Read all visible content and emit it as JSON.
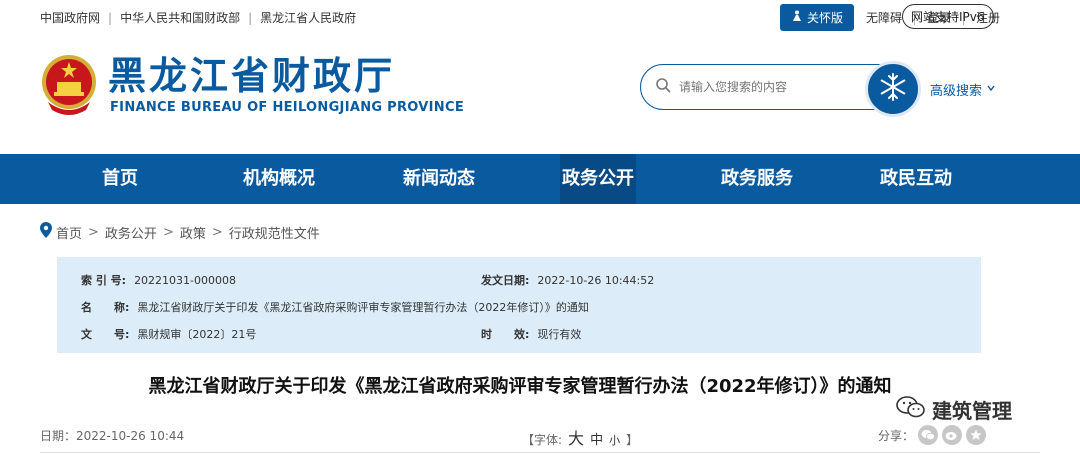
{
  "top_links": [
    "中国政府网",
    "中华人民共和国财政部",
    "黑龙江省人民政府"
  ],
  "top_right": {
    "care": "关怀版",
    "accessible": "无障碍",
    "login": "登录",
    "register": "注册",
    "ipv6": "网站支持IPv6"
  },
  "header": {
    "title": "黑龙江省财政厅",
    "subtitle": "FINANCE BUREAU OF HEILONGJIANG PROVINCE",
    "search_placeholder": "请输入您搜索的内容",
    "advanced_search": "高级搜索"
  },
  "nav": [
    "首页",
    "机构概况",
    "新闻动态",
    "政务公开",
    "政务服务",
    "政民互动"
  ],
  "nav_active": "政务公开",
  "breadcrumb": [
    "首页",
    "政务公开",
    "政策",
    "行政规范性文件"
  ],
  "info": {
    "index_label": "索 引 号:",
    "index_value": "20221031-000008",
    "date_label": "发文日期:",
    "date_value": "2022-10-26 10:44:52",
    "name_label": "名　　称:",
    "name_value": "黑龙江省财政厅关于印发《黑龙江省政府采购评审专家管理暂行办法（2022年修订）》的通知",
    "doc_label": "文　　号:",
    "doc_value": "黑财规审〔2022〕21号",
    "valid_label": "时　　效:",
    "valid_value": "现行有效"
  },
  "doc_title": "黑龙江省财政厅关于印发《黑龙江省政府采购评审专家管理暂行办法（2022年修订）》的通知",
  "watermark": "建筑管理",
  "meta": {
    "date": "日期：2022-10-26 10:44",
    "font_label": "【字体:",
    "font_big": "大",
    "font_mid": "中",
    "font_small": "小",
    "font_close": "】",
    "share_label": "分享："
  },
  "colors": {
    "primary": "#0a5aa0",
    "nav_active": "#084a86",
    "info_bg": "#dcedf9"
  }
}
